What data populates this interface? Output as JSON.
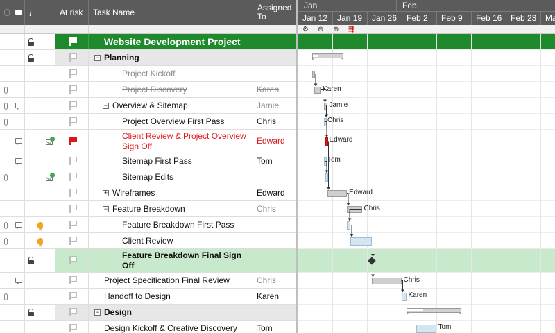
{
  "columns": {
    "at_risk": "At risk",
    "task_name": "Task Name",
    "assigned_to": "Assigned To"
  },
  "gantt_header": {
    "months": [
      {
        "label": "Jan"
      },
      {
        "label": "Feb"
      }
    ],
    "weeks": [
      "Jan 12",
      "Jan 19",
      "Jan 26",
      "Feb 2",
      "Feb 9",
      "Feb 16",
      "Feb 23",
      "Ma"
    ],
    "tools": [
      "settings-icon",
      "zoom-out-icon",
      "zoom-in-icon",
      "critical-path-icon"
    ]
  },
  "rows": [
    {
      "type": "project",
      "name": "Website Development Project",
      "assigned": "",
      "lock": true,
      "flag": "white"
    },
    {
      "type": "section",
      "name": "Planning",
      "assigned": "",
      "lock": true,
      "toggle": "−",
      "flag": "plain"
    },
    {
      "type": "task",
      "name": "Project Kickoff",
      "assigned": "",
      "status": "done",
      "flag": "plain",
      "indent": 2
    },
    {
      "type": "task",
      "name": "Project Discovery",
      "assigned": "Karen",
      "status": "done",
      "clip": true,
      "flag": "plain",
      "indent": 2
    },
    {
      "type": "subsection",
      "name": "Overview & Sitemap",
      "assigned": "Jamie",
      "assigned_style": "gray",
      "clip": true,
      "comment": true,
      "toggle": "−",
      "flag": "plain",
      "indent": 1
    },
    {
      "type": "task",
      "name": "Project Overview First Pass",
      "assigned": "Chris",
      "clip": true,
      "flag": "plain",
      "indent": 2
    },
    {
      "type": "task",
      "name": "Client Review & Project Overview Sign Off",
      "assigned": "Edward",
      "status": "alert",
      "comment": true,
      "mail": true,
      "flag": "red",
      "indent": 2,
      "tall": true
    },
    {
      "type": "task",
      "name": "Sitemap First Pass",
      "assigned": "Tom",
      "comment": true,
      "flag": "plain",
      "indent": 2
    },
    {
      "type": "task",
      "name": "Sitemap Edits",
      "assigned": "",
      "clip": true,
      "mail": true,
      "flag": "plain",
      "indent": 2
    },
    {
      "type": "subsection",
      "name": "Wireframes",
      "assigned": "Edward",
      "toggle": "+",
      "flag": "plain",
      "indent": 1
    },
    {
      "type": "subsection",
      "name": "Feature Breakdown",
      "assigned": "Chris",
      "assigned_style": "gray",
      "toggle": "−",
      "flag": "plain",
      "indent": 1
    },
    {
      "type": "task",
      "name": "Feature Breakdown First Pass",
      "assigned": "",
      "clip": true,
      "comment": true,
      "bell": true,
      "flag": "plain",
      "indent": 2
    },
    {
      "type": "task",
      "name": "Client Review",
      "assigned": "",
      "clip": true,
      "bell": true,
      "flag": "plain",
      "indent": 2
    },
    {
      "type": "milestone",
      "name": "Feature Breakdown Final Sign Off",
      "assigned": "",
      "lock": true,
      "status": "bold",
      "flag": "pale",
      "indent": 2,
      "tall": true
    },
    {
      "type": "subsection",
      "name": "Project Specification Final Review",
      "assigned": "Chris",
      "assigned_style": "gray",
      "comment": true,
      "flag": "plain",
      "indent": 1
    },
    {
      "type": "subsection",
      "name": "Handoff to Design",
      "assigned": "Karen",
      "clip": true,
      "flag": "plain",
      "indent": 1
    },
    {
      "type": "section",
      "name": "Design",
      "assigned": "",
      "lock": true,
      "toggle": "−",
      "flag": "plain"
    },
    {
      "type": "subsection",
      "name": "Design Kickoff & Creative Discovery",
      "assigned": "Tom",
      "flag": "plain",
      "indent": 1
    }
  ],
  "gantt_bars": [
    {
      "row": 0,
      "kind": "none"
    },
    {
      "row": 1,
      "kind": "summary",
      "start": 0.0,
      "end": 0.9,
      "progress": 0.18
    },
    {
      "row": 2,
      "kind": "gray",
      "start": 0.0,
      "end": 0.06,
      "label": ""
    },
    {
      "row": 3,
      "kind": "gray",
      "start": 0.06,
      "end": 0.24,
      "label": "Karen"
    },
    {
      "row": 4,
      "kind": "gray",
      "start": 0.33,
      "end": 0.43,
      "label": "Jamie"
    },
    {
      "row": 5,
      "kind": "blue",
      "start": 0.33,
      "end": 0.38,
      "label": "Chris"
    },
    {
      "row": 6,
      "kind": "red",
      "start": 0.38,
      "end": 0.43,
      "label": "Edward"
    },
    {
      "row": 7,
      "kind": "blue",
      "start": 0.33,
      "end": 0.38,
      "label": "Tom"
    },
    {
      "row": 8,
      "kind": "blue",
      "start": 0.38,
      "end": 0.43,
      "label": ""
    },
    {
      "row": 9,
      "kind": "gray",
      "start": 0.43,
      "end": 1.0,
      "label": "Edward"
    },
    {
      "row": 10,
      "kind": "gray",
      "start": 1.0,
      "end": 1.43,
      "label": "Chris"
    },
    {
      "row": 11,
      "kind": "blue",
      "start": 1.0,
      "end": 1.1,
      "label": ""
    },
    {
      "row": 12,
      "kind": "blue",
      "start": 1.1,
      "end": 1.71,
      "label": ""
    },
    {
      "row": 13,
      "kind": "milestone",
      "start": 1.71
    },
    {
      "row": 14,
      "kind": "gray",
      "start": 1.71,
      "end": 2.57,
      "label": "Chris"
    },
    {
      "row": 15,
      "kind": "blue",
      "start": 2.57,
      "end": 2.71,
      "label": "Karen"
    },
    {
      "row": 16,
      "kind": "summary",
      "start": 2.71,
      "end": 4.29,
      "progress": 0.3
    },
    {
      "row": 17,
      "kind": "blue",
      "start": 3.0,
      "end": 3.57,
      "label": "Tom"
    }
  ]
}
